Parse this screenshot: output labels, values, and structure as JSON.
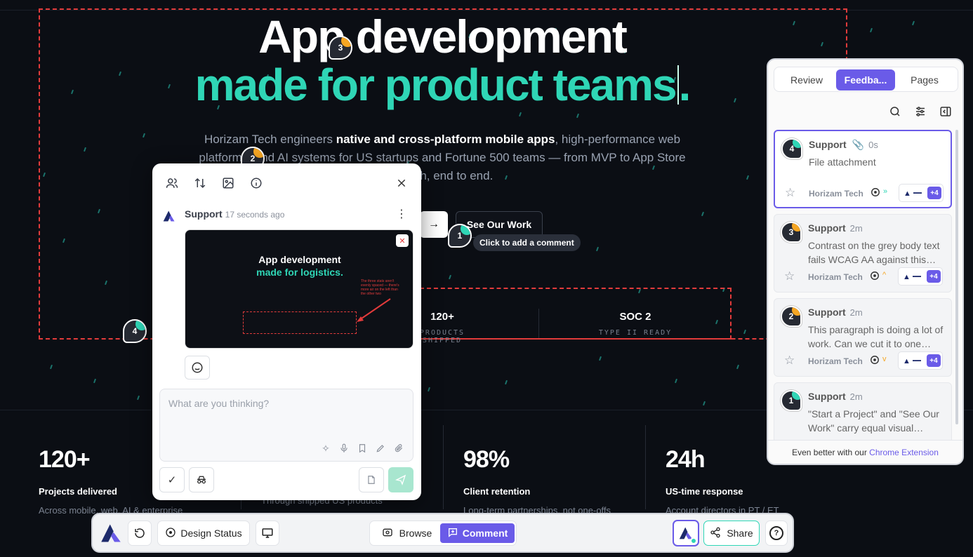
{
  "hero": {
    "title_line1": "App development",
    "title_line2": "made for product teams",
    "title_end": ".",
    "desc_pre": "Horizam Tech engineers ",
    "desc_bold": "native and cross-platform mobile apps",
    "desc_post": ", high-performance web platforms, and AI systems for US startups and Fortune 500 teams — from MVP to App Store launch, end to end.",
    "arrow_glyph": "→",
    "see_work_label": "See Our Work",
    "tooltip": "Click to add a comment"
  },
  "mini_stats": [
    {
      "value": "120+",
      "label": "PRODUCTS SHIPPED"
    },
    {
      "value": "SOC 2",
      "label": "TYPE II READY"
    }
  ],
  "stats": [
    {
      "number": "120+",
      "title": "Projects delivered",
      "sub": "Across mobile, web, AI & enterprise"
    },
    {
      "number": "",
      "title": "",
      "sub": "Through shipped US products"
    },
    {
      "number": "98%",
      "title": "Client retention",
      "sub": "Long-term partnerships, not one-offs"
    },
    {
      "number": "24h",
      "title": "US-time response",
      "sub": "Account directors in PT / ET"
    }
  ],
  "markers": [
    {
      "num": "1",
      "color": "#2fd6b6"
    },
    {
      "num": "2",
      "color": "#f5a623"
    },
    {
      "num": "3",
      "color": "#f5a623"
    },
    {
      "num": "4",
      "color": "#2fd6b6"
    }
  ],
  "popup": {
    "author": "Support",
    "time": "17 seconds ago",
    "shot_title1": "App development",
    "shot_title2": "made for logistics.",
    "shot_note": "The three stats aren't evenly spaced — there's more air on the left than the other two",
    "placeholder": "What are you thinking?",
    "icons": [
      "users-icon",
      "sort-icon",
      "image-icon",
      "info-icon",
      "close-icon",
      "more-icon",
      "emoji-icon",
      "sparkles-icon",
      "mic-icon",
      "bookmark-icon",
      "pen-icon",
      "attach-icon",
      "check-icon",
      "incognito-icon",
      "file-icon",
      "send-icon"
    ]
  },
  "panel": {
    "tabs": [
      "Review",
      "Feedba...",
      "Pages"
    ],
    "active_tab": 1,
    "cards": [
      {
        "num": "4",
        "color": "#2fd6b6",
        "author": "Support",
        "age": "0s",
        "text": "File attachment",
        "org": "Horizam Tech",
        "priority": "»",
        "priority_color": "#2fd6b6",
        "more": "+4"
      },
      {
        "num": "3",
        "color": "#f5a623",
        "author": "Support",
        "age": "2m",
        "text": "Contrast on the grey body text fails WCAG AA against this…",
        "org": "Horizam Tech",
        "priority": "^",
        "priority_color": "#f5a623",
        "more": "+4"
      },
      {
        "num": "2",
        "color": "#f5a623",
        "author": "Support",
        "age": "2m",
        "text": "This paragraph is doing a lot of work. Can we cut it to one…",
        "org": "Horizam Tech",
        "priority": "v",
        "priority_color": "#f5a623",
        "more": "+4"
      },
      {
        "num": "1",
        "color": "#2fd6b6",
        "author": "Support",
        "age": "2m",
        "text": "\"Start a Project\" and \"See Our Work\" carry equal visual…",
        "org": "",
        "priority": "",
        "priority_color": "#2fd6b6",
        "more": ""
      }
    ],
    "footer_text": "Even better with our ",
    "footer_link": "Chrome Extension"
  },
  "toolbar": {
    "design_status": "Design Status",
    "browse": "Browse",
    "comment": "Comment",
    "share": "Share",
    "help": "?"
  },
  "colors": {
    "accent": "#6a5be8",
    "teal": "#2fd6b6",
    "red_dash": "#e23b3b"
  }
}
